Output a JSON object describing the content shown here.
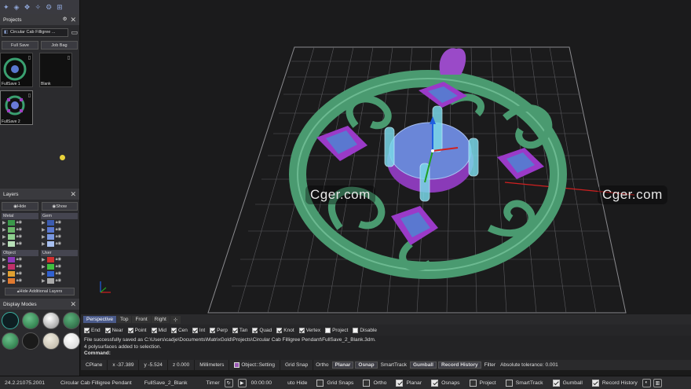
{
  "projects_panel": {
    "title": "Projects",
    "project_name": "Circular Cab Filligree ...",
    "full_save": "Full Save",
    "job_bag": "Job Bag",
    "thumbs": [
      {
        "label": "FullSave 1"
      },
      {
        "label": "Blank"
      },
      {
        "label": "FullSave 2"
      }
    ]
  },
  "layers_panel": {
    "title": "Layers",
    "hide": "Hide",
    "show": "Show",
    "groups": [
      {
        "name": "Metal",
        "colors": [
          "#3a9a4a",
          "#6ab86a",
          "#8fd08f",
          "#b8e0b8"
        ]
      },
      {
        "name": "Gem",
        "colors": [
          "#3c5cb0",
          "#5a78d0",
          "#7a98e0",
          "#a8c0f0"
        ]
      },
      {
        "name": "Object",
        "colors": [
          "#8a3ab8",
          "#c0306a",
          "#e0a030",
          "#e07a30"
        ]
      },
      {
        "name": "User",
        "colors": [
          "#d03030",
          "#40c040",
          "#3060d0",
          "#aaaaaa"
        ]
      }
    ],
    "hide_additional": "Hide Additional Layers"
  },
  "display_modes": {
    "title": "Display Modes"
  },
  "watermark": "Cger.com",
  "viewport_tabs": [
    "Perspective",
    "Top",
    "Front",
    "Right"
  ],
  "osnaps": [
    {
      "label": "End",
      "on": true
    },
    {
      "label": "Near",
      "on": true
    },
    {
      "label": "Point",
      "on": true
    },
    {
      "label": "Mid",
      "on": true
    },
    {
      "label": "Cen",
      "on": true
    },
    {
      "label": "Int",
      "on": true
    },
    {
      "label": "Perp",
      "on": true
    },
    {
      "label": "Tan",
      "on": true
    },
    {
      "label": "Quad",
      "on": true
    },
    {
      "label": "Knot",
      "on": true
    },
    {
      "label": "Vertex",
      "on": true
    },
    {
      "label": "Project",
      "on": false
    },
    {
      "label": "Disable",
      "on": false
    }
  ],
  "command": {
    "line1": "File successfully saved as C:\\Users\\cadje\\Documents\\MatrixGold\\Projects\\Circular Cab Filligree Pendant\\FullSave_2_Blank.3dm.",
    "line2": "4 polysurfaces added to selection.",
    "prompt": "Command:"
  },
  "status": {
    "cplane": "CPlane",
    "x": "x -37.389",
    "y": "y -5.524",
    "z": "z 0.000",
    "units": "Millimeters",
    "layer": "Object::Setting",
    "grid_snap": "Grid Snap",
    "ortho": "Ortho",
    "planar": "Planar",
    "osnap": "Osnap",
    "smarttrack": "SmartTrack",
    "gumball": "Gumball",
    "record_history": "Record History",
    "filter": "Filter",
    "tolerance": "Absolute tolerance: 0.001"
  },
  "bottom": {
    "version": "24.2.21075.2001",
    "project": "Circular Cab Filligree Pendant",
    "file": "FullSave_2_Blank",
    "timer": "Timer",
    "time": "00:00:00",
    "auto_hide": "uto Hide",
    "toggles": [
      {
        "label": "Grid Snaps",
        "on": false
      },
      {
        "label": "Ortho",
        "on": false
      },
      {
        "label": "Planar",
        "on": true
      },
      {
        "label": "Osnaps",
        "on": true
      },
      {
        "label": "Project",
        "on": false
      },
      {
        "label": "SmartTrack",
        "on": false
      },
      {
        "label": "Gumball",
        "on": true
      },
      {
        "label": "Record History",
        "on": true
      }
    ]
  }
}
